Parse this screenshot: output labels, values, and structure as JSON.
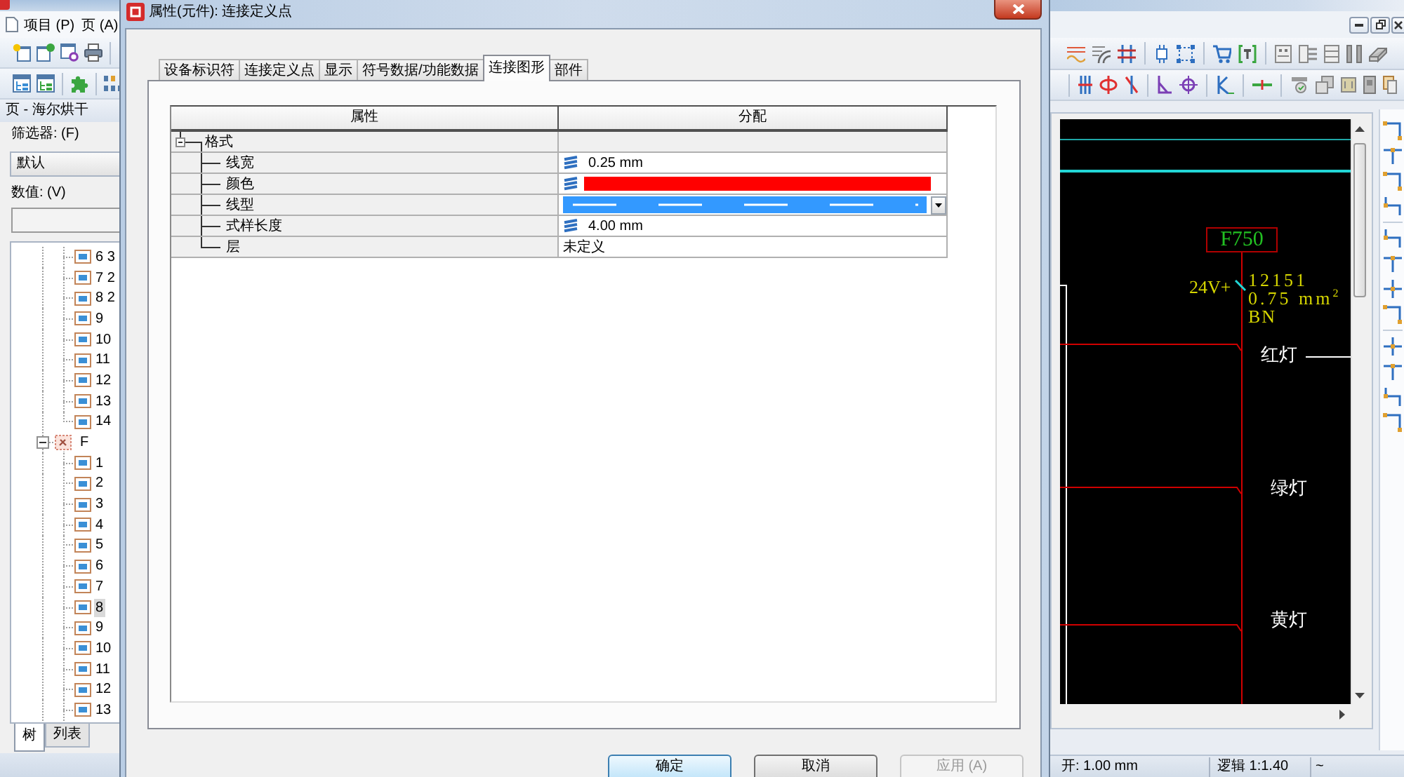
{
  "app": {
    "menu": [
      {
        "label": "项目 (P)"
      },
      {
        "label": "页 (A)"
      }
    ],
    "page_panel": {
      "title": "页 - 海尔烘干",
      "filter_label": "筛选器: (F)",
      "filter_value": "默认",
      "value_label": "数值: (V)",
      "tree": [
        {
          "children": [
            {
              "label": "6 3",
              "selected": false
            },
            {
              "label": "7 2",
              "selected": false
            },
            {
              "label": "8 2",
              "selected": false
            },
            {
              "label": "9",
              "selected": false
            },
            {
              "label": "10",
              "selected": false
            },
            {
              "label": "11",
              "selected": false
            },
            {
              "label": "12",
              "selected": false
            },
            {
              "label": "13",
              "selected": false
            },
            {
              "label": "14",
              "selected": false
            }
          ]
        },
        {
          "label": "F",
          "expanded": true,
          "selected": false,
          "children": [
            {
              "label": "1",
              "selected": false
            },
            {
              "label": "2",
              "selected": false
            },
            {
              "label": "3",
              "selected": false
            },
            {
              "label": "4",
              "selected": false
            },
            {
              "label": "5",
              "selected": false
            },
            {
              "label": "6",
              "selected": false
            },
            {
              "label": "7",
              "selected": false
            },
            {
              "label": "8",
              "selected": true
            },
            {
              "label": "9",
              "selected": false
            },
            {
              "label": "10",
              "selected": false
            },
            {
              "label": "11",
              "selected": false
            },
            {
              "label": "12",
              "selected": false
            },
            {
              "label": "13",
              "selected": false
            }
          ]
        }
      ],
      "tabs": [
        {
          "label": "树",
          "selected": true
        },
        {
          "label": "列表",
          "selected": false
        }
      ]
    },
    "canvas": {
      "device_tag": "F750",
      "terminal_label": "24V+",
      "wire_number": "12151",
      "cross_section": "0.75 mm$^{2}$",
      "wire_color": "BN",
      "lamp_labels": [
        "红灯",
        "绿灯",
        "黄灯"
      ]
    },
    "status_bar": [
      "开: 1.00 mm",
      "逻辑 1:1.40",
      "~"
    ]
  },
  "dialog": {
    "title": "属性(元件): 连接定义点",
    "tabs": [
      {
        "label": "设备标识符",
        "selected": false
      },
      {
        "label": "连接定义点",
        "selected": false
      },
      {
        "label": "显示",
        "selected": false
      },
      {
        "label": "符号数据/功能数据",
        "selected": false
      },
      {
        "label": "连接图形",
        "selected": true
      },
      {
        "label": "部件",
        "selected": false
      }
    ],
    "table": {
      "columns": [
        "属性",
        "分配"
      ],
      "groups": [
        {
          "name": "格式",
          "expanded": true,
          "selected": false,
          "children": [
            {
              "kind": "value",
              "name": "线宽",
              "value": "0.25 mm",
              "selected": false
            },
            {
              "kind": "color",
              "name": "颜色",
              "color": "#ff0000",
              "selected": false
            },
            {
              "kind": "linetype",
              "name": "线型",
              "selected": true
            },
            {
              "kind": "value",
              "name": "式样长度",
              "value": "4.00 mm",
              "selected": false
            },
            {
              "kind": "text",
              "name": "层",
              "value": "未定义",
              "selected": false
            }
          ]
        }
      ]
    },
    "buttons": [
      {
        "label": "确定",
        "default": true,
        "disabled": false
      },
      {
        "label": "取消",
        "default": false,
        "disabled": false
      },
      {
        "label": "应用 (A)",
        "default": false,
        "disabled": true
      }
    ]
  }
}
